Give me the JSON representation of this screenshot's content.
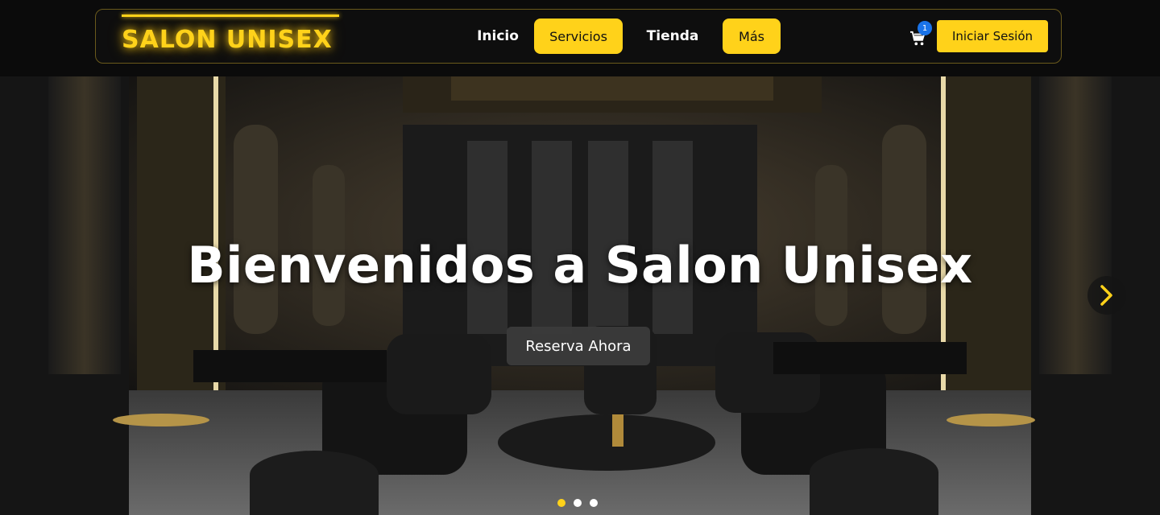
{
  "brand": {
    "name": "SALON UNISEX"
  },
  "nav": {
    "items": [
      {
        "label": "Inicio",
        "highlighted": false
      },
      {
        "label": "Servicios",
        "highlighted": true
      },
      {
        "label": "Tienda",
        "highlighted": false
      },
      {
        "label": "Más",
        "highlighted": true
      }
    ]
  },
  "cart": {
    "icon": "cart-icon",
    "count": "1"
  },
  "auth": {
    "login_label": "Iniciar Sesión"
  },
  "hero": {
    "title": "Bienvenidos a Salon Unisex",
    "cta_label": "Reserva Ahora",
    "next_icon": "chevron-right-icon",
    "slides": 3,
    "active_slide": 1
  },
  "colors": {
    "accent": "#ffd21a",
    "nav_bg": "#0e0e0e",
    "badge": "#1a73e8",
    "cta_bg": "#3c3c3c"
  }
}
